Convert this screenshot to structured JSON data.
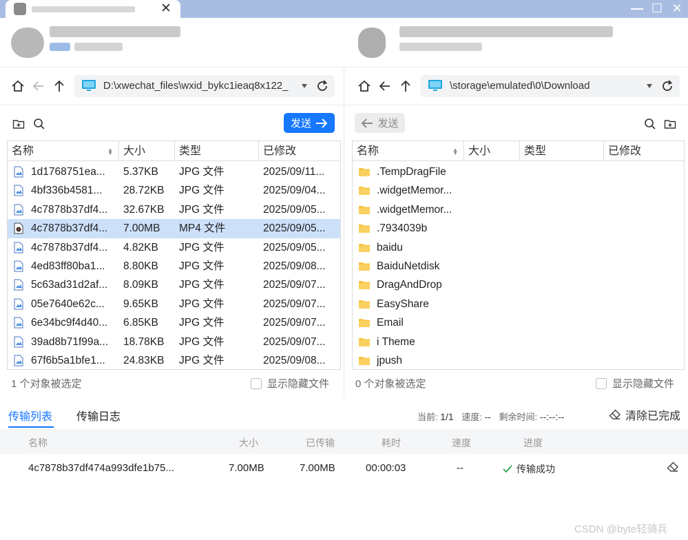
{
  "window": {
    "close_glyph": "✕",
    "controls": {
      "minimize": "—",
      "maximize": "☐",
      "close": "✕"
    }
  },
  "left": {
    "path": "D:\\xwechat_files\\wxid_bykc1ieaq8x122_",
    "send_label": "发送",
    "columns": {
      "name": "名称",
      "size": "大小",
      "type": "类型",
      "modified": "已修改"
    },
    "files": [
      {
        "name": "1d1768751ea...",
        "size": "5.37KB",
        "type": "JPG 文件",
        "modified": "2025/09/11...",
        "kind": "image"
      },
      {
        "name": "4bf336b4581...",
        "size": "28.72KB",
        "type": "JPG 文件",
        "modified": "2025/09/04...",
        "kind": "image"
      },
      {
        "name": "4c7878b37df4...",
        "size": "32.67KB",
        "type": "JPG 文件",
        "modified": "2025/09/05...",
        "kind": "image"
      },
      {
        "name": "4c7878b37df4...",
        "size": "7.00MB",
        "type": "MP4 文件",
        "modified": "2025/09/05...",
        "kind": "video",
        "selected": true
      },
      {
        "name": "4c7878b37df4...",
        "size": "4.82KB",
        "type": "JPG 文件",
        "modified": "2025/09/05...",
        "kind": "image"
      },
      {
        "name": "4ed83ff80ba1...",
        "size": "8.80KB",
        "type": "JPG 文件",
        "modified": "2025/09/08...",
        "kind": "image"
      },
      {
        "name": "5c63ad31d2af...",
        "size": "8.09KB",
        "type": "JPG 文件",
        "modified": "2025/09/07...",
        "kind": "image"
      },
      {
        "name": "05e7640e62c...",
        "size": "9.65KB",
        "type": "JPG 文件",
        "modified": "2025/09/07...",
        "kind": "image"
      },
      {
        "name": "6e34bc9f4d40...",
        "size": "6.85KB",
        "type": "JPG 文件",
        "modified": "2025/09/07...",
        "kind": "image"
      },
      {
        "name": "39ad8b71f99a...",
        "size": "18.78KB",
        "type": "JPG 文件",
        "modified": "2025/09/07...",
        "kind": "image"
      },
      {
        "name": "67f6b5a1bfe1...",
        "size": "24.83KB",
        "type": "JPG 文件",
        "modified": "2025/09/08...",
        "kind": "image"
      }
    ],
    "status": "1 个对象被选定",
    "show_hidden": "显示隐藏文件"
  },
  "right": {
    "path": "\\storage\\emulated\\0\\Download",
    "send_label": "发送",
    "columns": {
      "name": "名称",
      "size": "大小",
      "type": "类型",
      "modified": "已修改"
    },
    "folders": [
      ".TempDragFile",
      ".widgetMemor...",
      ".widgetMemor...",
      ".7934039b",
      "baidu",
      "BaiduNetdisk",
      "DragAndDrop",
      "EasyShare",
      "Email",
      "i Theme",
      "jpush"
    ],
    "status": "0 个对象被选定",
    "show_hidden": "显示隐藏文件"
  },
  "transfer": {
    "tabs": [
      "传输列表",
      "传输日志"
    ],
    "current_label": "当前:",
    "current_value": "1/1",
    "speed_label": "速度:",
    "speed_value": "--",
    "remaining_label": "剩余时间:",
    "remaining_value": "--:--:--",
    "clear_label": "清除已完成",
    "headers": {
      "name": "名称",
      "size": "大小",
      "transferred": "已传输",
      "elapsed": "耗时",
      "speed": "速度",
      "progress": "进度"
    },
    "rows": [
      {
        "name": "4c7878b37df474a993dfe1b75...",
        "size": "7.00MB",
        "transferred": "7.00MB",
        "elapsed": "00:00:03",
        "speed": "--",
        "progress": "传输成功"
      }
    ]
  },
  "watermark": "CSDN @byte轻骑兵",
  "colors": {
    "accent": "#1677ff",
    "titlebar": "#a9bde3",
    "selected_row": "#cce0fa",
    "folder": "#f7c443",
    "success": "#2ba24c"
  }
}
